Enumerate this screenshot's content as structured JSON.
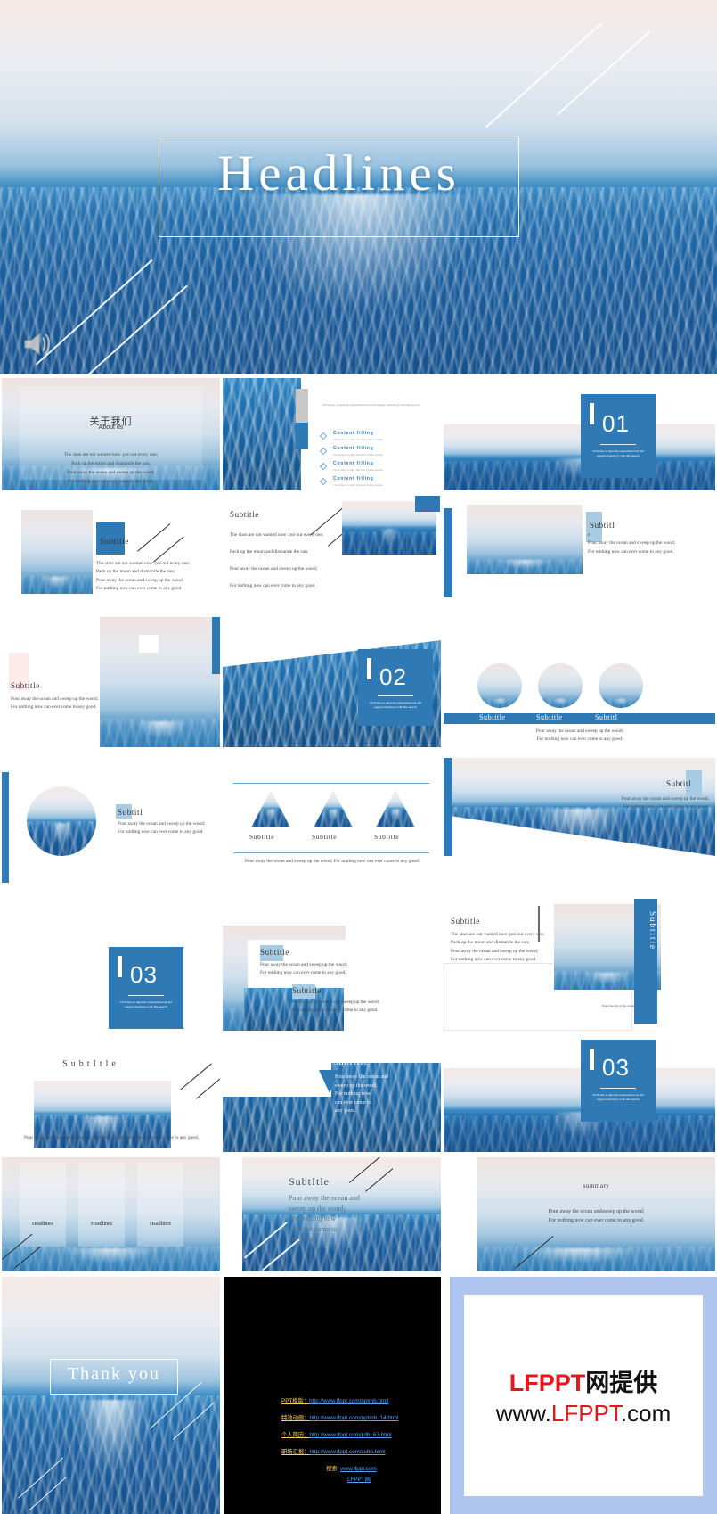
{
  "hero": {
    "title": "Headlines",
    "speaker_icon": "speaker-icon"
  },
  "poem": {
    "line1": "The stars are not wanted now: put out every one;",
    "line2": "Pack up the moon and dismantle the sun;",
    "line3": "Pour away the ocean and sweep up the wood;",
    "line4": "For nothing now can ever come to any good."
  },
  "common": {
    "subtitle": "Subtitle",
    "subtitle_alt": "SubtItle",
    "subtitle_trunc": "Subtitl",
    "subtitle_vertical": "Subtitle",
    "headlines": "Headlines",
    "placeholder_long": "Click here to input the replacement text and suggest replacing it with this speech",
    "placeholder_short": "Click here to enter the text of this section",
    "content_filling": "Content filling",
    "num_caption": "Click here to input the replacement text and suggest replacing it with this speech.",
    "contents_watermark": "contents",
    "enter_title_here": "Enter the title of the content"
  },
  "slides": {
    "about_cn": "关于我们",
    "about_en": "About us",
    "summary": "summary",
    "summary_line1": "Pour away the ocean andsweep up the wood;",
    "summary_line2": "For nothing now can ever come to any good.",
    "thank_you": "Thank  you",
    "num01": "01",
    "num02": "02",
    "num03": "03"
  },
  "section_text": {
    "pour_block": "Pour away the ocean and sweep up the wood;\nFor nothing now can ever come to any good.",
    "pour_wrapped": "Pour away the ocean and sweep up the wood; For nothing now can ever come to any good.",
    "pour_short": "Pour away the ocean and\nsweep up the wood;\nFor nothing now\ncan ever come to\nany good."
  },
  "links": {
    "items": [
      {
        "label": "PPT模版：",
        "url": "http://www.lfppt.com/pptmb.html"
      },
      {
        "label": "特效动画：",
        "url": "http://www.lfppt.com/pptmb_14.html"
      },
      {
        "label": "个人简历：",
        "url": "http://www.lfppt.com/jldb_67.html"
      },
      {
        "label": "职场汇报：",
        "url": "http://www.lfppt.com/zchb.html"
      }
    ],
    "search_label": "搜索:",
    "search_site": "www.lfppt.com",
    "search_name": "LFPPT网"
  },
  "watermark": {
    "line1_red": "LFPPT",
    "line1_black": "网提供",
    "line2_pre": "www.",
    "line2_red": "LFPPT",
    "line2_post": ".com"
  },
  "colors": {
    "accent": "#2f79b5",
    "accent_light": "#a8cbe4",
    "pale": "#cfe2f1",
    "panel_bg": "#aec6ef",
    "link_label": "#ffd24d",
    "link_url": "#4fa3ff",
    "brand_red": "#e8161a"
  }
}
